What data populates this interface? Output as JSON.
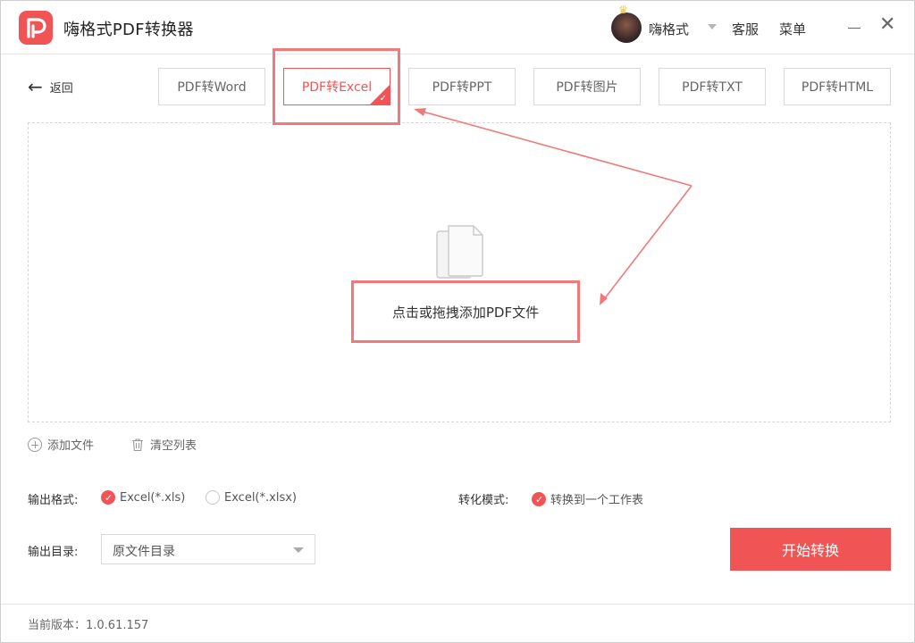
{
  "app": {
    "title": "嗨格式PDF转换器",
    "brand_color": "#f05454",
    "logo_icon": "pdf-logo-icon"
  },
  "header": {
    "user_name": "嗨格式",
    "service_label": "客服",
    "menu_label": "菜单"
  },
  "nav": {
    "back_label": "返回"
  },
  "tabs": [
    {
      "label": "PDF转Word",
      "active": false
    },
    {
      "label": "PDF转Excel",
      "active": true
    },
    {
      "label": "PDF转PPT",
      "active": false
    },
    {
      "label": "PDF转图片",
      "active": false
    },
    {
      "label": "PDF转TXT",
      "active": false
    },
    {
      "label": "PDF转HTML",
      "active": false
    }
  ],
  "dropzone": {
    "hint": "点击或拖拽添加PDF文件",
    "annotation_color": "#f07a7a"
  },
  "file_actions": {
    "add_label": "添加文件",
    "clear_label": "清空列表"
  },
  "options": {
    "format_label": "输出格式:",
    "formats": [
      {
        "label": "Excel(*.xls)",
        "selected": true
      },
      {
        "label": "Excel(*.xlsx)",
        "selected": false
      }
    ],
    "mode_label": "转化模式:",
    "mode_value": "转换到一个工作表",
    "mode_selected": true,
    "dir_label": "输出目录:",
    "dir_value": "原文件目录"
  },
  "actions": {
    "start_label": "开始转换"
  },
  "footer": {
    "version_text": "当前版本：1.0.61.157"
  }
}
